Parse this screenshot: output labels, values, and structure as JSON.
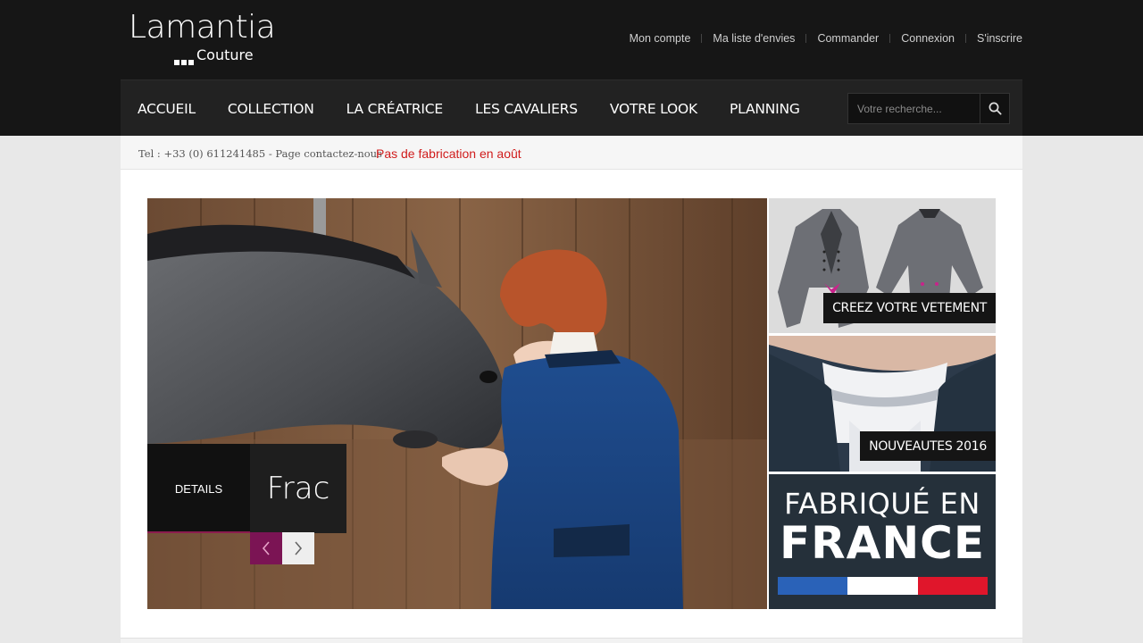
{
  "brand": {
    "name": "Lamantia",
    "subtitle": "Couture"
  },
  "top_links": [
    "Mon compte",
    "Ma liste d'envies",
    "Commander",
    "Connexion",
    "S'inscrire"
  ],
  "nav": [
    "ACCUEIL",
    "COLLECTION",
    "LA CRÉATRICE",
    "LES CAVALIERS",
    "VOTRE LOOK",
    "PLANNING"
  ],
  "search": {
    "placeholder": "Votre recherche...",
    "icon": "search-icon"
  },
  "info": {
    "phone": "Tel : +33 (0) 611241485 - Page contactez-nous",
    "notice": "Pas de fabrication en août"
  },
  "slider": {
    "details_label": "DETAILS",
    "slide_title": "Frac",
    "prev_icon": "chevron-left-icon",
    "next_icon": "chevron-right-icon"
  },
  "tiles": {
    "create": "CREEZ VOTRE VETEMENT",
    "new": "NOUVEAUTES 2016",
    "made_line1": "FABRIQUÉ EN",
    "made_line2": "FRANCE"
  },
  "colors": {
    "header_bg": "#161616",
    "nav_bg": "#222222",
    "notice_red": "#d01c1c",
    "accent_plum": "#7b1454",
    "flag_blue": "#2a62b8",
    "flag_white": "#ffffff",
    "flag_red": "#e0162b"
  }
}
